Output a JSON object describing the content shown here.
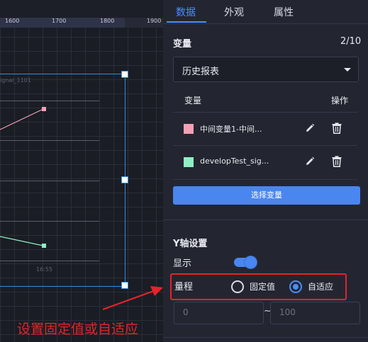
{
  "ruler": {
    "ticks": [
      "1600",
      "1700",
      "1800",
      "1900"
    ]
  },
  "canvas": {
    "signal_label": "ignal_1101",
    "time_label": "16:55",
    "series_colors": {
      "pink": "#f4a0b5",
      "green": "#8ff0c4"
    }
  },
  "tabs": [
    {
      "label": "数据",
      "active": true
    },
    {
      "label": "外观",
      "active": false
    },
    {
      "label": "属性",
      "active": false
    }
  ],
  "variables": {
    "title": "变量",
    "count": "2/10",
    "selected_report": "历史报表",
    "col_variable": "变量",
    "col_actions": "操作",
    "rows": [
      {
        "name": "中间变量1-中间...",
        "color": "#f4a0b5"
      },
      {
        "name": "developTest_sig...",
        "color": "#8ff0c4"
      }
    ],
    "choose_button": "选择变量"
  },
  "y_axis": {
    "title": "Y轴设置",
    "show_label": "显示",
    "show_enabled": true,
    "range_label": "量程",
    "options": [
      {
        "label": "固定值",
        "selected": false
      },
      {
        "label": "自适应",
        "selected": true
      }
    ],
    "min_placeholder": "0",
    "separator": "~",
    "max_placeholder": "100"
  },
  "annotation": {
    "text": "设置固定值或自适应",
    "color": "#e8222a"
  },
  "colors": {
    "accent": "#4c8dff",
    "button": "#4a86f0",
    "panel_bg": "#232631"
  }
}
